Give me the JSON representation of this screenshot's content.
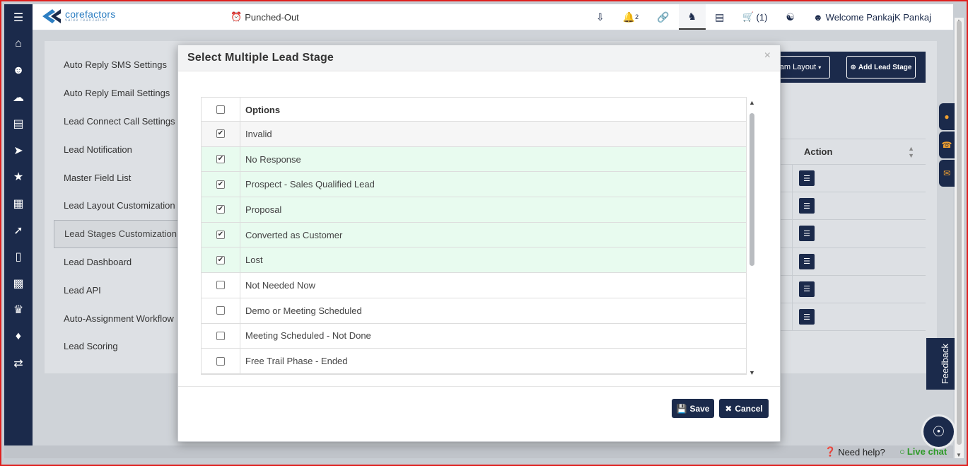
{
  "header": {
    "brand": "corefactors",
    "brand_tagline": "value realization",
    "punch_status": "Punched-Out",
    "notification_count": "2",
    "cart": "(1)",
    "welcome": "Welcome PankajK Pankaj"
  },
  "leftnav": {
    "icons": [
      "menu-icon",
      "home-icon",
      "user-icon",
      "cloud-icon",
      "list-icon",
      "megaphone-icon",
      "team-icon",
      "table-icon",
      "rocket-icon",
      "mobile-icon",
      "grid-icon",
      "trophy-icon",
      "ticket-icon",
      "shuffle-icon"
    ]
  },
  "settings": {
    "items": [
      {
        "label": "Auto Reply SMS Settings"
      },
      {
        "label": "Auto Reply Email Settings"
      },
      {
        "label": "Lead Connect Call Settings"
      },
      {
        "label": "Lead Notification"
      },
      {
        "label": "Master Field List"
      },
      {
        "label": "Lead Layout Customization"
      },
      {
        "label": "Lead Stages Customization"
      },
      {
        "label": "Lead Dashboard"
      },
      {
        "label": "Lead API"
      },
      {
        "label": "Auto-Assignment Workflow"
      },
      {
        "label": "Lead Scoring"
      }
    ],
    "active_index": 6
  },
  "background_toolbar": {
    "layout_button": "am Layout",
    "add_button": "Add Lead Stage"
  },
  "background_table": {
    "action_header": "Action",
    "row_count": 6
  },
  "modal": {
    "title": "Select Multiple Lead Stage",
    "close": "×",
    "options_header": "Options",
    "options": [
      {
        "label": "Invalid",
        "checked": true
      },
      {
        "label": "No Response",
        "checked": true
      },
      {
        "label": "Prospect - Sales Qualified Lead",
        "checked": true
      },
      {
        "label": "Proposal",
        "checked": true
      },
      {
        "label": "Converted as Customer",
        "checked": true
      },
      {
        "label": "Lost",
        "checked": true
      },
      {
        "label": "Not Needed Now",
        "checked": false
      },
      {
        "label": "Demo or Meeting Scheduled",
        "checked": false
      },
      {
        "label": "Meeting Scheduled - Not Done",
        "checked": false
      },
      {
        "label": "Free Trail Phase - Ended",
        "checked": false
      }
    ],
    "save_label": "Save",
    "cancel_label": "Cancel"
  },
  "widgets": {
    "feedback": "Feedback",
    "need_help": "Need help?",
    "live_chat": "Live chat"
  },
  "colors": {
    "navy": "#1b2a4b",
    "checked_row": "#e8fbef",
    "live_chat": "#2e9a28"
  }
}
